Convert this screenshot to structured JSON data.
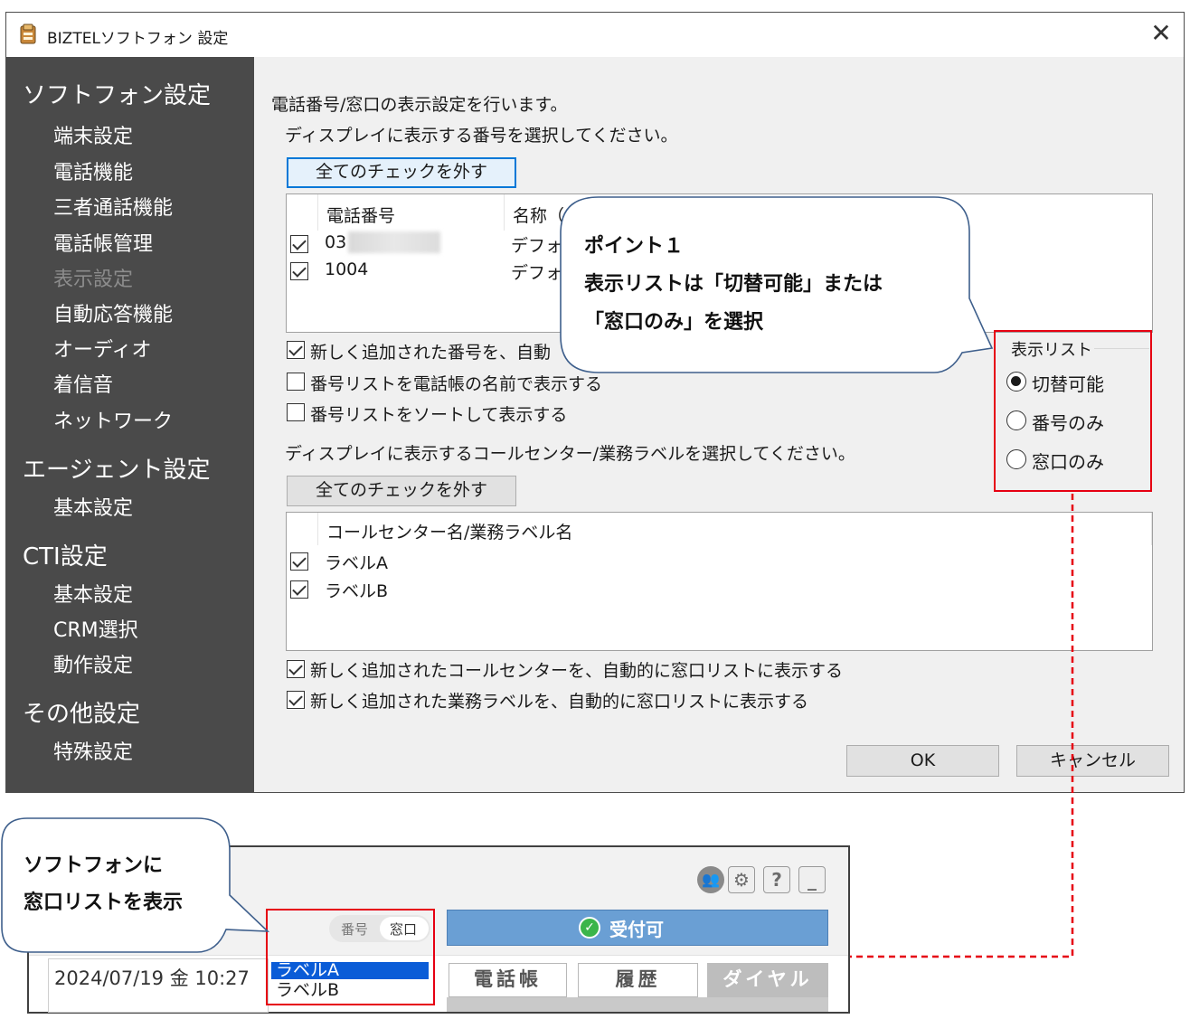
{
  "window": {
    "title": "BIZTELソフトフォン 設定"
  },
  "sidebar": {
    "sections": [
      {
        "heading": "ソフトフォン設定",
        "items": [
          "端末設定",
          "電話機能",
          "三者通話機能",
          "電話帳管理",
          "表示設定",
          "自動応答機能",
          "オーディオ",
          "着信音",
          "ネットワーク"
        ]
      },
      {
        "heading": "エージェント設定",
        "items": [
          "基本設定"
        ]
      },
      {
        "heading": "CTI設定",
        "items": [
          "基本設定",
          "CRM選択",
          "動作設定"
        ]
      },
      {
        "heading": "その他設定",
        "items": [
          "特殊設定"
        ]
      }
    ],
    "disabled_item": "表示設定"
  },
  "content": {
    "intro": "電話番号/窓口の表示設定を行います。",
    "number_prompt": "ディスプレイに表示する番号を選択してください。",
    "uncheck_all_1": "全てのチェックを外す",
    "numbers_table": {
      "headers": [
        "電話番号",
        "名称（"
      ],
      "rows": [
        {
          "checked": true,
          "number": "03",
          "name": "デフォ"
        },
        {
          "checked": true,
          "number": "1004",
          "name": "デフォ"
        }
      ]
    },
    "options_numbers": [
      {
        "checked": true,
        "label": "新しく追加された番号を、自動"
      },
      {
        "checked": false,
        "label": "番号リストを電話帳の名前で表示する"
      },
      {
        "checked": false,
        "label": "番号リストをソートして表示する"
      }
    ],
    "label_prompt": "ディスプレイに表示するコールセンター/業務ラベルを選択してください。",
    "uncheck_all_2": "全てのチェックを外す",
    "labels_table": {
      "header": "コールセンター名/業務ラベル名",
      "rows": [
        {
          "checked": true,
          "label": "ラベルA"
        },
        {
          "checked": true,
          "label": "ラベルB"
        }
      ]
    },
    "options_labels": [
      {
        "checked": true,
        "label": "新しく追加されたコールセンターを、自動的に窓口リストに表示する"
      },
      {
        "checked": true,
        "label": "新しく追加された業務ラベルを、自動的に窓口リストに表示する"
      }
    ],
    "display_list": {
      "legend": "表示リスト",
      "options": [
        "切替可能",
        "番号のみ",
        "窓口のみ"
      ],
      "selected": "切替可能"
    },
    "ok_label": "OK",
    "cancel_label": "キャンセル"
  },
  "callout_point": {
    "line1": "ポイント１",
    "line2": "表示リストは「切替可能」または",
    "line3": "「窓口のみ」を選択"
  },
  "callout_phone": {
    "line1": "ソフトフォンに",
    "line2": "窓口リストを表示"
  },
  "softphone": {
    "toggle": [
      "番号",
      "窓口"
    ],
    "status": "受付可",
    "datetime": "2024/07/19 金 10:27",
    "list_items": [
      "ラベルA",
      "ラベルB"
    ],
    "tabs": [
      "電話帳",
      "履歴",
      "ダイヤル"
    ],
    "icons": [
      "users-icon",
      "gear-icon",
      "help-icon",
      "minimize-icon"
    ]
  },
  "colors": {
    "highlight": "#e60012",
    "sidebar": "#4a4a4a",
    "status_bar": "#6a9fd4",
    "selection": "#0a5cd7"
  }
}
